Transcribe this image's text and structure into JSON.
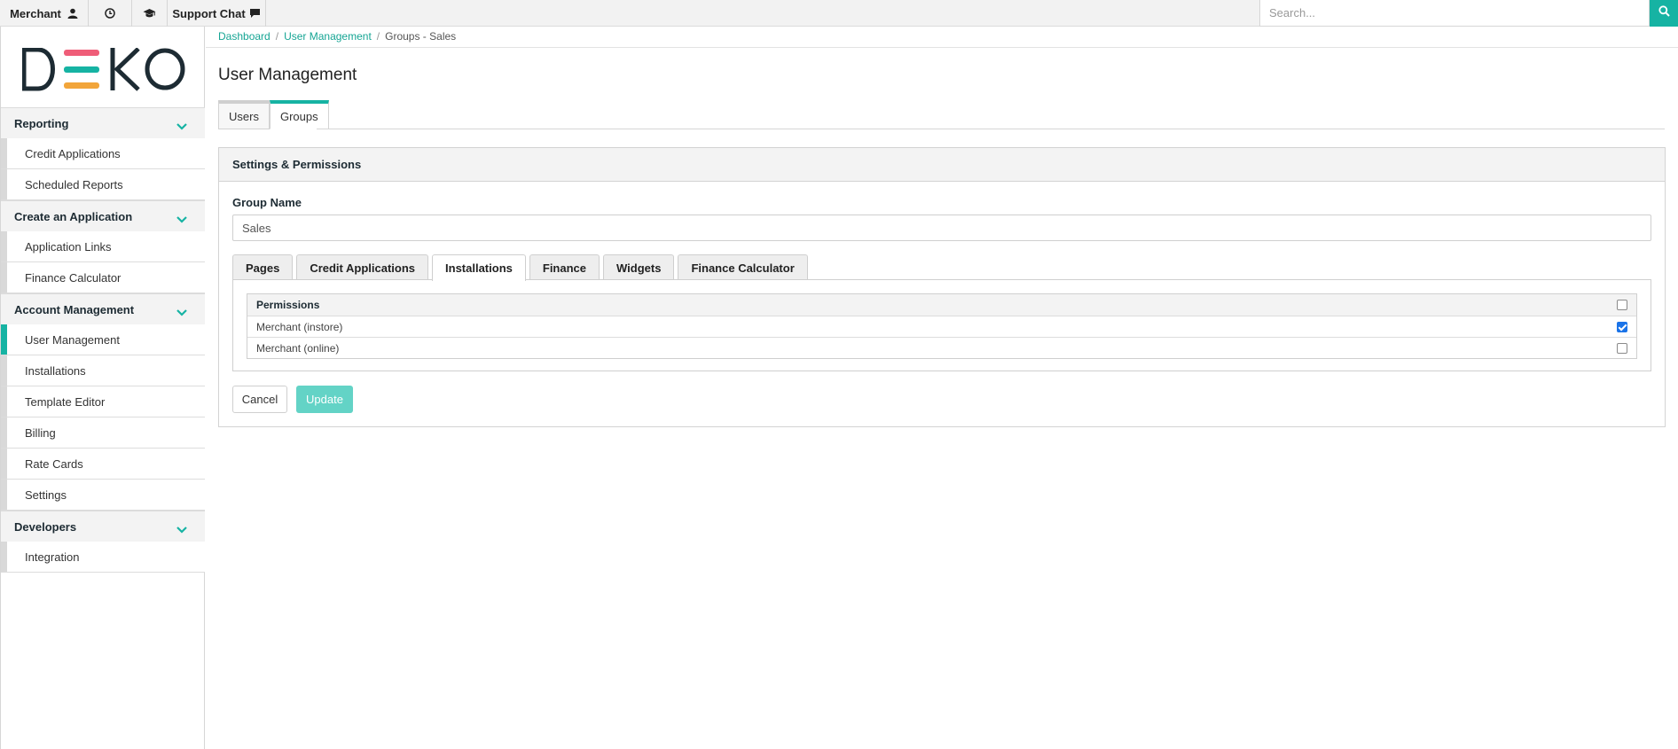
{
  "topbar": {
    "merchant_label": "Merchant",
    "support_label": "Support Chat",
    "search_placeholder": "Search..."
  },
  "brand": {
    "logo_text": "DEKO",
    "accent": "#16b3a3"
  },
  "sidebar": {
    "sections": [
      {
        "label": "Reporting",
        "items": [
          "Credit Applications",
          "Scheduled Reports"
        ]
      },
      {
        "label": "Create an Application",
        "items": [
          "Application Links",
          "Finance Calculator"
        ]
      },
      {
        "label": "Account Management",
        "items": [
          "User Management",
          "Installations",
          "Template Editor",
          "Billing",
          "Rate Cards",
          "Settings"
        ]
      },
      {
        "label": "Developers",
        "items": [
          "Integration"
        ]
      }
    ],
    "active_item": "User Management"
  },
  "breadcrumb": {
    "dashboard": "Dashboard",
    "user_management": "User Management",
    "current": "Groups - Sales"
  },
  "page": {
    "title": "User Management",
    "tabs": [
      "Users",
      "Groups"
    ],
    "active_tab": "Groups"
  },
  "panel": {
    "title": "Settings & Permissions",
    "group_name_label": "Group Name",
    "group_name_value": "Sales",
    "perm_tabs": [
      "Pages",
      "Credit Applications",
      "Installations",
      "Finance",
      "Widgets",
      "Finance Calculator"
    ],
    "active_perm_tab": "Installations",
    "permissions_header": "Permissions",
    "permissions": [
      {
        "label": "Merchant (instore)",
        "checked": true
      },
      {
        "label": "Merchant (online)",
        "checked": false
      }
    ],
    "cancel_label": "Cancel",
    "update_label": "Update"
  }
}
